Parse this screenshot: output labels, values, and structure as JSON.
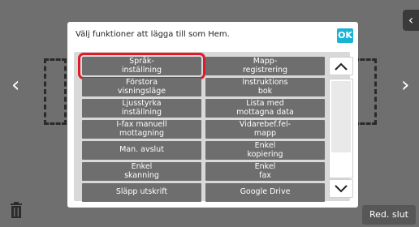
{
  "dialog": {
    "title": "Välj funktioner att lägga till som Hem.",
    "ok_label": "OK"
  },
  "functions": [
    {
      "label": "Språk-\ninställning",
      "selected": true
    },
    {
      "label": "Mapp-\nregistrering",
      "selected": false
    },
    {
      "label": "Förstora\nvisningsläge",
      "selected": false
    },
    {
      "label": "Instruktions\nbok",
      "selected": false
    },
    {
      "label": "Ljusstyrka\ninställning",
      "selected": false
    },
    {
      "label": "Lista med\nmottagna data",
      "selected": false
    },
    {
      "label": "I-fax manuell\nmottagning",
      "selected": false
    },
    {
      "label": "Vidarebef.fel-\nmapp",
      "selected": false
    },
    {
      "label": "Man. avslut",
      "selected": false
    },
    {
      "label": "Enkel\nkopiering",
      "selected": false
    },
    {
      "label": "Enkel\nskanning",
      "selected": false
    },
    {
      "label": "Enkel\nfax",
      "selected": false
    },
    {
      "label": "Släpp utskrift",
      "selected": false
    },
    {
      "label": "Google Drive",
      "selected": false
    }
  ],
  "footer": {
    "red_slut_label": "Red. slut"
  },
  "colors": {
    "accent": "#19b3d6",
    "selection": "#e0192b",
    "button": "#6e6e6e"
  }
}
